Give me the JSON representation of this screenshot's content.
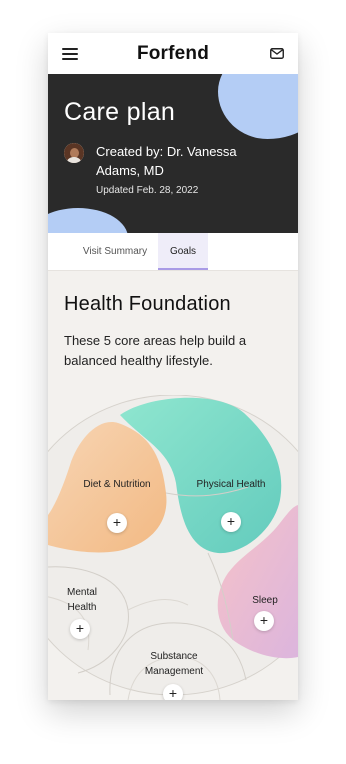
{
  "header": {
    "brand": "Forfend",
    "menu_icon": "hamburger-menu-icon",
    "mail_icon": "mail-icon"
  },
  "hero": {
    "title": "Care plan",
    "creator": "Created by: Dr. Vanessa Adams, MD",
    "updated": "Updated Feb. 28, 2022",
    "accent_color": "#b4cdf5",
    "background_color": "#2a2a2a"
  },
  "tabs": [
    {
      "label": "Visit Summary",
      "active": false
    },
    {
      "label": "Goals",
      "active": true
    }
  ],
  "section": {
    "title": "Health Foundation",
    "description": "These 5 core areas help build a balanced healthy lifestyle."
  },
  "areas": [
    {
      "label": "Diet & Nutrition",
      "color": "#f4c9a0",
      "action": "+"
    },
    {
      "label": "Physical Health",
      "color": "#7fd9c8",
      "action": "+"
    },
    {
      "label": "Mental Health",
      "color": "#f3f1ee",
      "action": "+"
    },
    {
      "label": "Sleep",
      "color": "#e9bcd6",
      "action": "+"
    },
    {
      "label": "Substance Management",
      "color": "#f3f1ee",
      "action": "+"
    }
  ]
}
